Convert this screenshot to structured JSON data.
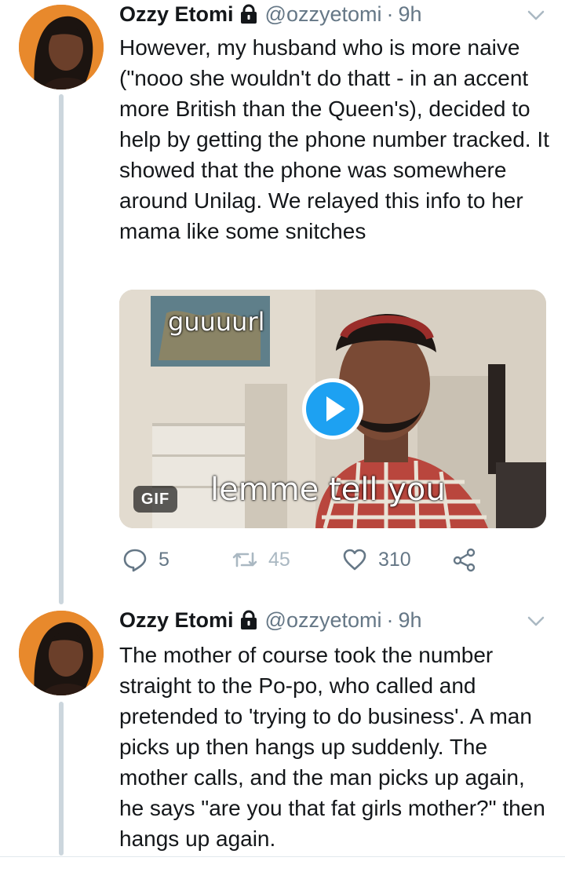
{
  "tweets": [
    {
      "author_name": "Ozzy Etomi",
      "handle": "@ozzyetomi",
      "separator": "·",
      "time": "9h",
      "text": "However, my husband who is more naive (\"nooo she wouldn't do thatt - in an accent more British than the Queen's), decided to help by getting the phone number tracked. It showed that the phone was somewhere around Unilag. We relayed this info to her mama like some snitches",
      "media": {
        "badge": "GIF",
        "caption_top": "guuuurl",
        "caption_bottom": "lemme tell you"
      },
      "actions": {
        "replies": "5",
        "retweets": "45",
        "likes": "310"
      }
    },
    {
      "author_name": "Ozzy Etomi",
      "handle": "@ozzyetomi",
      "separator": "·",
      "time": "9h",
      "text": "The mother of course took the number straight to the Po-po, who called and pretended to 'trying to do business'. A man picks up then hangs up suddenly. The mother calls, and the man picks up again, he says \"are you that fat girls mother?\" then hangs up again."
    }
  ],
  "icons": {
    "lock": "lock-icon",
    "chevron": "chevron-down-icon",
    "reply": "reply-icon",
    "retweet": "retweet-icon",
    "like": "heart-icon",
    "share": "share-icon",
    "play": "play-icon"
  },
  "colors": {
    "accent": "#1da1f2",
    "secondary_text": "#657786",
    "thread_line": "#ccd6dd",
    "retweet_disabled": "#aab8c2"
  }
}
